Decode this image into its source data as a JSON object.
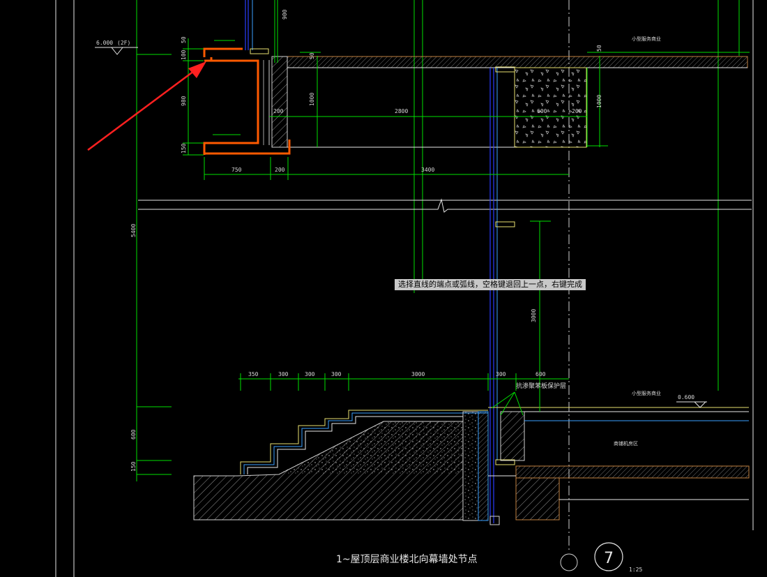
{
  "drawing": {
    "title": "1~屋顶层商业楼北向幕墙处节点",
    "detail_number": "7",
    "scale": "1:25"
  },
  "levels": {
    "upper": "6.000",
    "upper_floor": "(2F)",
    "lower": "0.600"
  },
  "dimensions": {
    "top_50_left": "50",
    "top_100_left": "100",
    "top_980_left": "980",
    "top_150_left": "150",
    "top_900": "900",
    "top_50_mid": "50",
    "top_1000_a": "1000",
    "top_1000_b": "1000",
    "top_50_right": "50",
    "top_200_a": "200",
    "top_2800": "2800",
    "top_600": "600",
    "top_200_b": "200",
    "bottom_750": "750",
    "bottom_200": "200",
    "bottom_3400": "3400",
    "side_5400": "5400",
    "side_3000": "3000",
    "side_600": "600",
    "side_150": "150",
    "stair_350": "350",
    "stair_300_a": "300",
    "stair_300_b": "300",
    "stair_300_c": "300",
    "stair_3000": "3000",
    "stair_300_d": "300",
    "stair_600": "600"
  },
  "annotations": {
    "upper_room": "小型服务商业",
    "lower_room": "小型服务商业",
    "lower_zone": "商铺机房区",
    "waterproof_note": "抗渗聚苯板保护层"
  },
  "status": {
    "command_prompt": "选择直线的端点或弧线，空格键退回上一点，右键完成"
  },
  "colors": {
    "background": "#000000",
    "dimension": "#00e000",
    "highlight": "#ff5a00",
    "arrow": "#ff2020",
    "curtain_wall": "#2a3cff"
  }
}
